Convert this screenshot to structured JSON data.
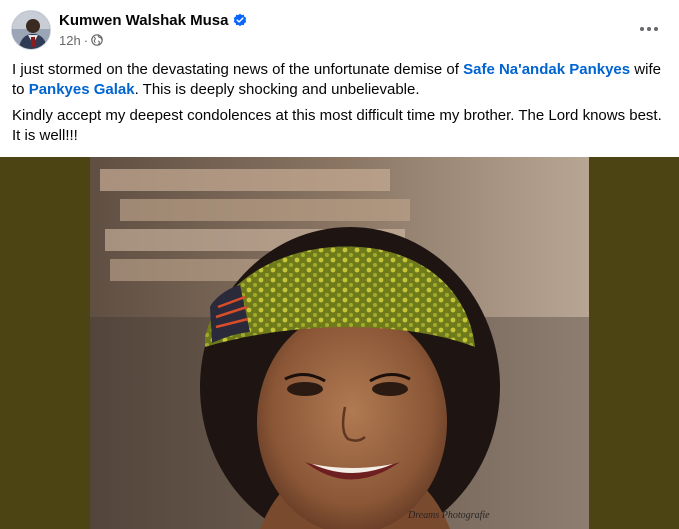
{
  "post": {
    "author": {
      "name": "Kumwen Walshak Musa",
      "verified": true
    },
    "meta": {
      "time": "12h",
      "separator": "·",
      "privacy_icon": "globe-icon"
    },
    "more_icon": "ellipsis-icon",
    "text": {
      "p1_a": "I just stormed on the devastating news of the unfortunate demise of ",
      "p1_mention1": "Safe Na'andak Pankyes",
      "p1_b": " wife to ",
      "p1_mention2": "Pankyes Galak",
      "p1_c": ". This is deeply shocking and unbelievable.",
      "p2": "Kindly accept my deepest condolences at this most difficult time my brother. The Lord knows best. It is well!!!"
    },
    "photo": {
      "watermark": "Dreams Photografie"
    }
  },
  "colors": {
    "link": "#0064d1",
    "meta": "#65676b",
    "verified": "#0866ff",
    "photo_background": "#4d4414"
  }
}
